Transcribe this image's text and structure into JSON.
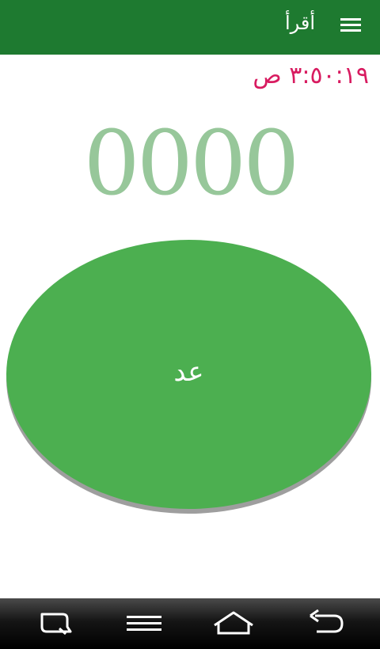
{
  "app_bar": {
    "title": "أقرأ",
    "menu_icon": "hamburger-menu-icon",
    "color": "#1e7a30"
  },
  "clock": {
    "time": "٣:٥٠:١٩ ص",
    "color": "#d81b60"
  },
  "counter": {
    "value": "0000",
    "color": "#97c79a"
  },
  "count_button": {
    "label": "عد",
    "color": "#4caf50"
  },
  "nav_bar": {
    "items": [
      {
        "icon": "recent-apps-icon"
      },
      {
        "icon": "menu-icon"
      },
      {
        "icon": "home-icon"
      },
      {
        "icon": "back-icon"
      }
    ]
  }
}
